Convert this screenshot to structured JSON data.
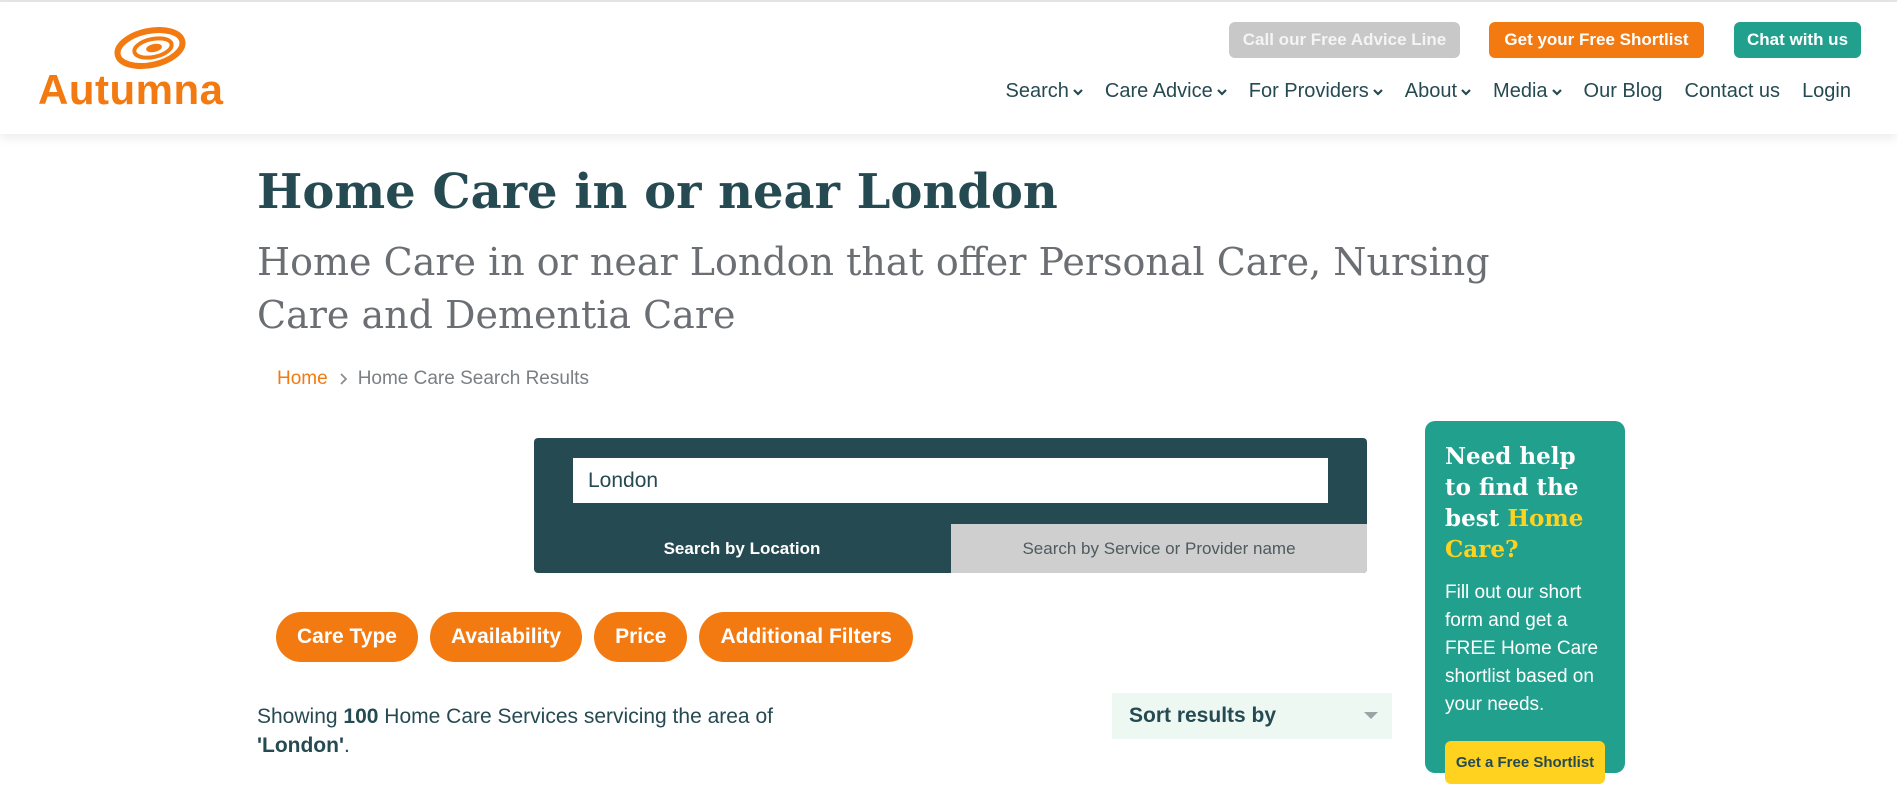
{
  "brand": {
    "name": "Autumna",
    "color": "#f27a10"
  },
  "header": {
    "buttons": {
      "advice": "Call our Free Advice Line",
      "shortlist": "Get your Free Shortlist",
      "chat": "Chat with us"
    },
    "nav": [
      {
        "label": "Search",
        "dropdown": true
      },
      {
        "label": "Care Advice",
        "dropdown": true
      },
      {
        "label": "For Providers",
        "dropdown": true
      },
      {
        "label": "About",
        "dropdown": true
      },
      {
        "label": "Media",
        "dropdown": true
      },
      {
        "label": "Our Blog",
        "dropdown": false
      },
      {
        "label": "Contact us",
        "dropdown": false
      },
      {
        "label": "Login",
        "dropdown": false
      }
    ]
  },
  "page": {
    "title": "Home Care in or near London",
    "subtitle": "Home Care in or near London that offer Personal Care, Nursing Care and Dementia Care"
  },
  "breadcrumb": {
    "home": "Home",
    "current": "Home Care Search Results"
  },
  "search": {
    "value": "London",
    "tab_location": "Search by Location",
    "tab_name": "Search by Service or Provider name"
  },
  "filters": [
    "Care Type",
    "Availability",
    "Price",
    "Additional Filters"
  ],
  "results": {
    "prefix": "Showing",
    "count": "100",
    "middle": "Home Care Services servicing the area of",
    "location": "'London'",
    "suffix": "."
  },
  "sort": {
    "label": "Sort results by"
  },
  "help_card": {
    "heading_line1": "Need help to find the best",
    "heading_highlight": "Home Care?",
    "body": "Fill out our short form and get a FREE Home Care shortlist based on your needs.",
    "button": "Get a Free Shortlist"
  },
  "colors": {
    "primary_dark": "#264a52",
    "orange": "#f27a10",
    "teal": "#21a08e",
    "yellow": "#ffd21f"
  },
  "icons": {
    "nav_dropdown": "chevron-down-icon",
    "breadcrumb_separator": "chevron-right-icon",
    "sort": "caret-down-icon"
  }
}
